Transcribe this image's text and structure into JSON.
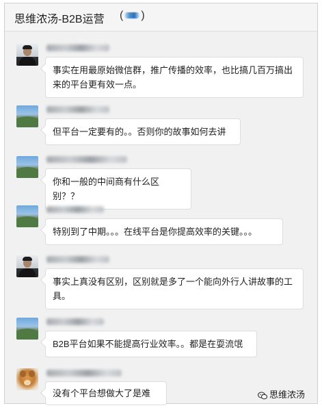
{
  "header": {
    "title": "思维浓汤-B2B运营",
    "member_count_prefix": "(",
    "member_count_suffix": ")"
  },
  "messages": [
    {
      "avatar": "person-avatar",
      "text": "事实在用最原始微信群，推广传播的效率，也比搞几百万搞出来的平台更有效一点。"
    },
    {
      "avatar": "landscape-avatar",
      "text": "但平台一定要有的。。否则你的故事如何去讲"
    },
    {
      "avatar": "landscape-avatar",
      "text": "你和一般的中间商有什么区别？？"
    },
    {
      "avatar": "landscape-avatar",
      "text": "特别到了中期。。。在线平台是你提高效率的关键。。。"
    },
    {
      "avatar": "person-avatar",
      "text": "事实上真没有区别，区别就是多了一个能向外行人讲故事的工具。"
    },
    {
      "avatar": "landscape-avatar",
      "text": "B2B平台如果不能提高行业效率。。都是在耍流氓"
    },
    {
      "avatar": "dog-avatar",
      "text": "没有个平台想做大了是难"
    }
  ],
  "watermark": {
    "text": "思维浓汤",
    "icon": "wechat-icon"
  },
  "colors": {
    "background": "#f1f1f1",
    "bubble": "#ffffff",
    "text": "#1f1f1f"
  }
}
